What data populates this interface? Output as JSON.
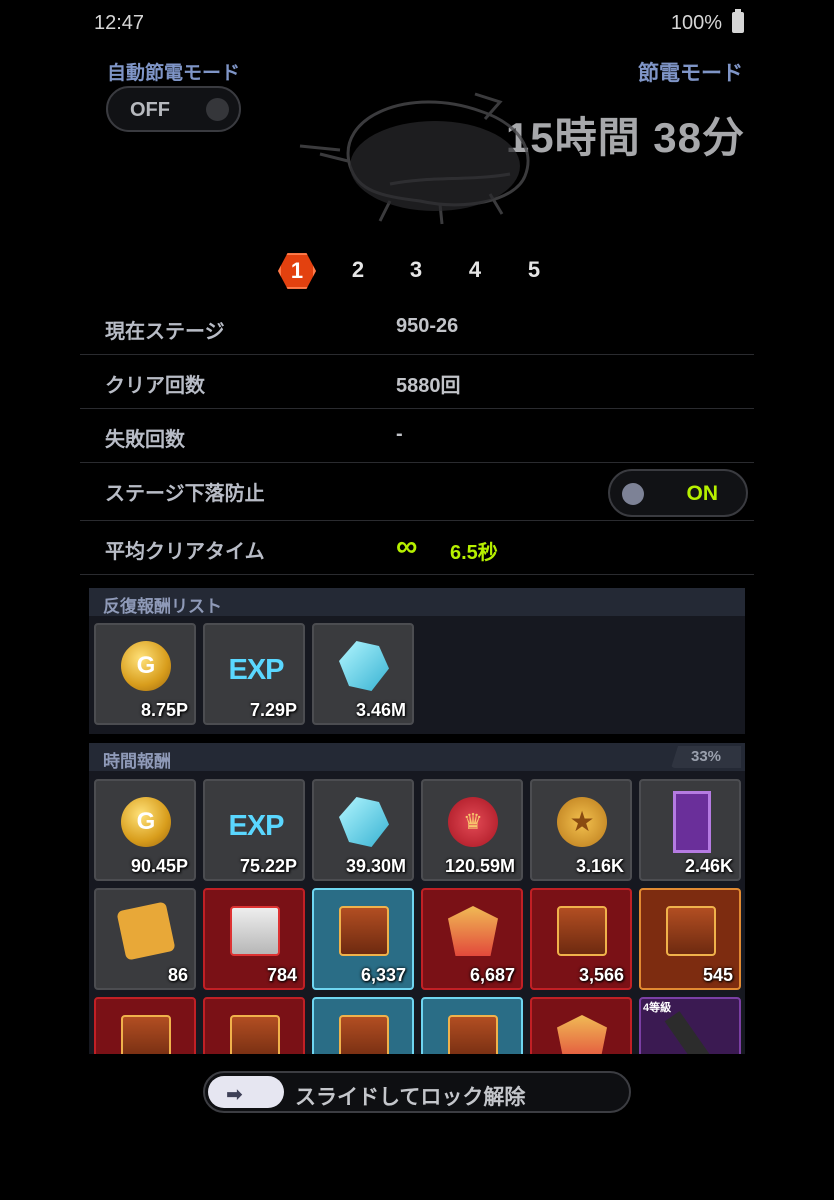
{
  "status": {
    "time": "12:47",
    "battery": "100%"
  },
  "auto_mode": {
    "label": "自動節電モード",
    "state": "OFF"
  },
  "save_mode": {
    "label": "節電モード",
    "remaining": "15時間 38分"
  },
  "pager": {
    "pages": [
      "1",
      "2",
      "3",
      "4",
      "5"
    ],
    "active": "1"
  },
  "info": {
    "stage_label": "現在ステージ",
    "stage_value": "950-26",
    "clear_label": "クリア回数",
    "clear_value": "5880回",
    "fail_label": "失敗回数",
    "fail_value": "-",
    "prevent_label": "ステージ下落防止",
    "prevent_state": "ON",
    "avg_label": "平均クリアタイム",
    "avg_value": "6.5秒",
    "avg_icon": "∞"
  },
  "repeat_rewards": {
    "title": "反復報酬リスト",
    "items": [
      {
        "icon": "gold-coin",
        "value": "8.75P"
      },
      {
        "icon": "exp",
        "value": "7.29P"
      },
      {
        "icon": "crystal",
        "value": "3.46M"
      }
    ]
  },
  "time_rewards": {
    "title": "時間報酬",
    "percent": "33%",
    "items": [
      {
        "icon": "gold-coin",
        "value": "90.45P"
      },
      {
        "icon": "exp",
        "value": "75.22P"
      },
      {
        "icon": "crystal",
        "value": "39.30M"
      },
      {
        "icon": "red-seal",
        "value": "120.59M"
      },
      {
        "icon": "gold-medal",
        "value": "3.16K"
      },
      {
        "icon": "purple-card",
        "value": "2.46K"
      },
      {
        "icon": "dice",
        "value": "86"
      },
      {
        "icon": "book-chest",
        "value": "784"
      },
      {
        "icon": "mystery-chest",
        "value": "6,337"
      },
      {
        "icon": "emblem",
        "value": "6,687"
      },
      {
        "icon": "treasure-chest",
        "value": "3,566"
      },
      {
        "icon": "locked-chest",
        "value": "545"
      }
    ],
    "partial_tag": "4等級"
  },
  "lock": {
    "label": "スライドしてロック解除",
    "arrow": "➡"
  }
}
